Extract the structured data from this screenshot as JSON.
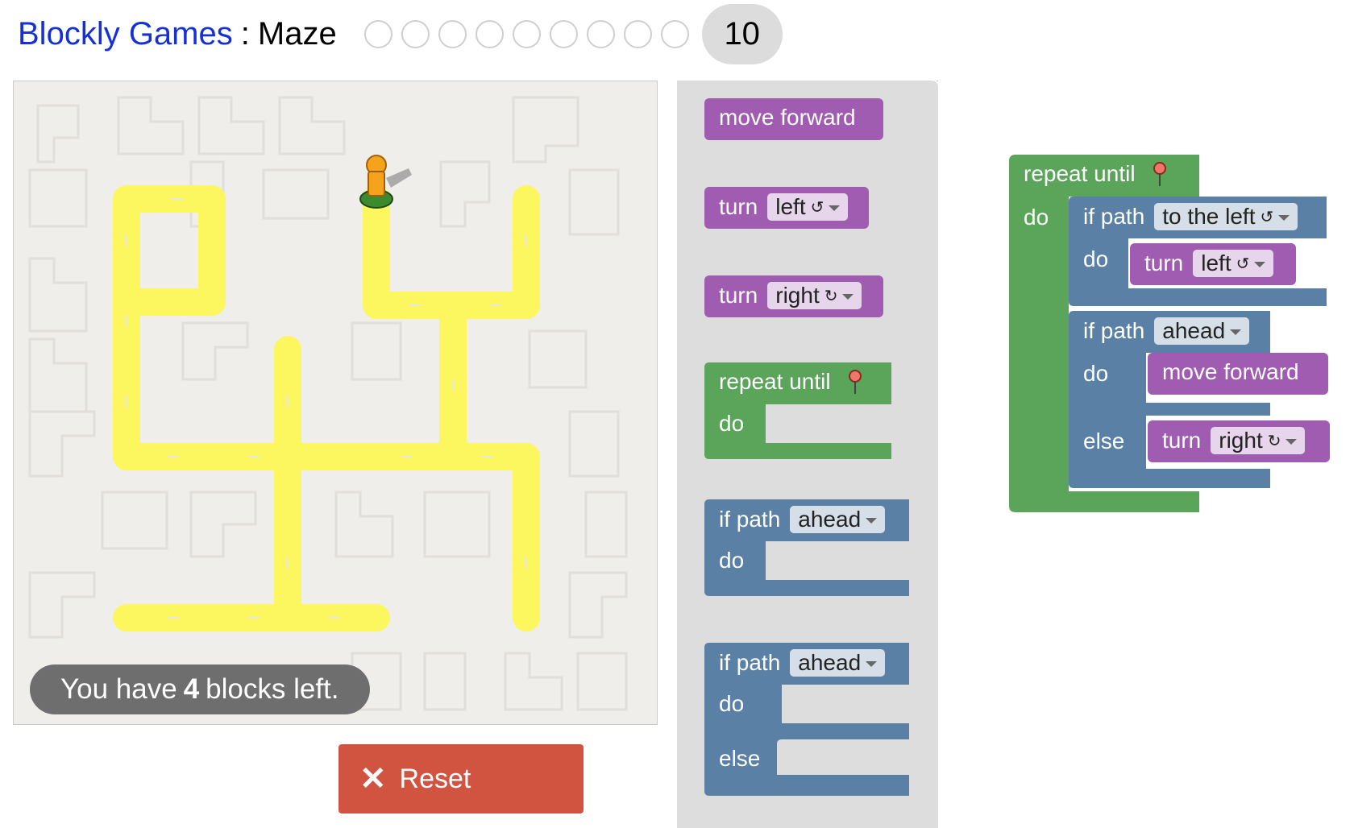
{
  "header": {
    "app_name": "Blockly Games",
    "separator": ":",
    "page_name": "Maze",
    "levels": [
      "1",
      "2",
      "3",
      "4",
      "5",
      "6",
      "7",
      "8",
      "9"
    ],
    "current_level": "10"
  },
  "maze": {
    "capacity_prefix": "You have",
    "capacity_count": "4",
    "capacity_suffix": "blocks left."
  },
  "reset_button": {
    "label": "Reset",
    "icon": "close-icon"
  },
  "toolbox": {
    "move_forward": "move forward",
    "turn_left": {
      "label": "turn",
      "value": "left",
      "glyph": "↺"
    },
    "turn_right": {
      "label": "turn",
      "value": "right",
      "glyph": "↻"
    },
    "repeat_until": {
      "label": "repeat until",
      "do": "do",
      "icon": "map-pin-icon"
    },
    "if_path": {
      "label": "if path",
      "value": "ahead",
      "do": "do"
    },
    "if_else": {
      "label": "if path",
      "value": "ahead",
      "do": "do",
      "else": "else"
    }
  },
  "workspace": {
    "repeat_label": "repeat until",
    "repeat_do": "do",
    "if1": {
      "label": "if path",
      "value": "to the left",
      "glyph": "↺",
      "do": "do",
      "turn_label": "turn",
      "turn_value": "left",
      "turn_glyph": "↺"
    },
    "if2": {
      "label": "if path",
      "value": "ahead",
      "do": "do",
      "move": "move forward",
      "else": "else",
      "turn_label": "turn",
      "turn_value": "right",
      "turn_glyph": "↻"
    }
  },
  "colors": {
    "link": "#1530d6",
    "reset": "#d05440",
    "path": "#fcf75e",
    "motion": "#a05cb0",
    "loop": "#5ba55b",
    "logic": "#5b80a5"
  }
}
